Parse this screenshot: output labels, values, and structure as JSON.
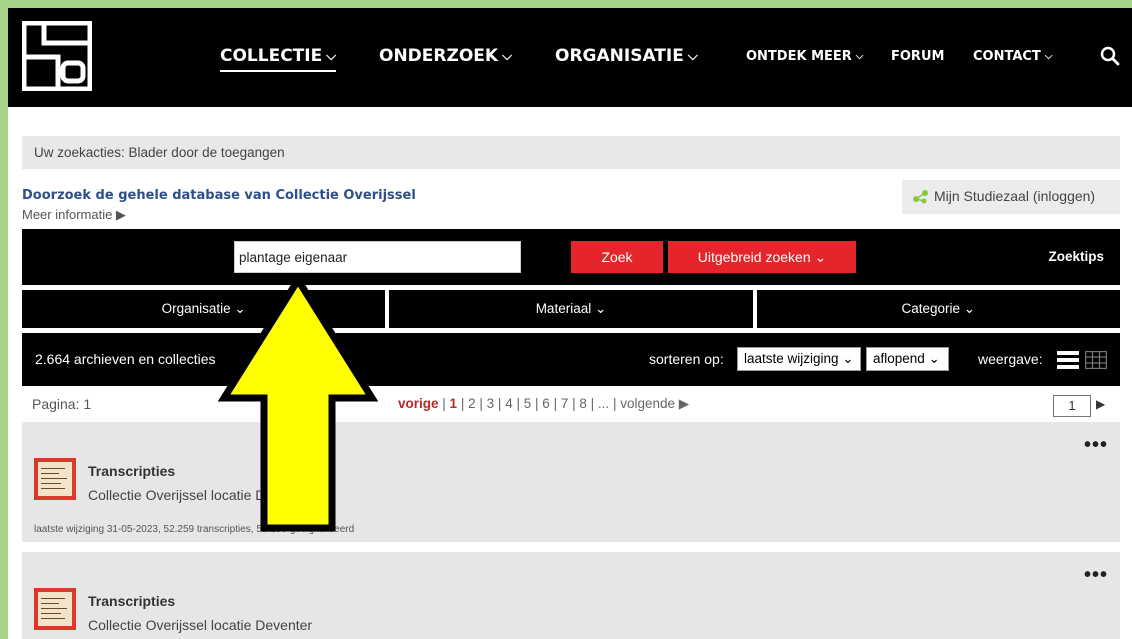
{
  "nav": {
    "items": [
      {
        "label": "COLLECTIE",
        "chevron": true
      },
      {
        "label": "ONDERZOEK",
        "chevron": true
      },
      {
        "label": "ORGANISATIE",
        "chevron": true
      },
      {
        "label": "ONTDEK MEER",
        "chevron": true
      },
      {
        "label": "FORUM",
        "chevron": false
      },
      {
        "label": "CONTACT",
        "chevron": true
      }
    ]
  },
  "breadcrumb": "Uw zoekacties: Blader door de toegangen",
  "database_link": "Doorzoek de gehele database van Collectie Overijssel",
  "more_info": "Meer informatie ▶",
  "studiezaal": "Mijn Studiezaal (inloggen)",
  "search": {
    "value": "plantage eigenaar",
    "zoek_label": "Zoek",
    "advanced_label": "Uitgebreid zoeken ⌄",
    "tips_label": "Zoektips"
  },
  "filters": {
    "organisatie": "Organisatie ⌄",
    "materiaal": "Materiaal ⌄",
    "categorie": "Categorie ⌄"
  },
  "results": {
    "count": "2.664 archieven en collecties",
    "sort_label": "sorteren op:",
    "sort_value": "laatste wijziging ⌄",
    "order_value": "aflopend ⌄",
    "view_label": "weergave:"
  },
  "pagination": {
    "label": "Pagina: 1",
    "prev": "vorige",
    "pages": [
      "1",
      "2",
      "3",
      "4",
      "5",
      "6",
      "7",
      "8",
      "..."
    ],
    "next": "volgende ▶",
    "current": "1",
    "next_arrow": "▶"
  },
  "items": [
    {
      "title": "Transcripties",
      "subtitle": "Collectie Overijssel locatie Deventer",
      "meta": "laatste wijziging 31-05-2023, 52.259 transcripties, 52.259 gedigitaliseerd",
      "menu": "•••"
    },
    {
      "title": "Transcripties",
      "subtitle": "Collectie Overijssel locatie Deventer",
      "menu": "•••"
    }
  ],
  "colors": {
    "header_bg": "#000000",
    "accent_red": "#e4252b",
    "link_blue": "#2d4f8e",
    "arrow_yellow": "#ffff00",
    "page_border_green": "#a8d48a"
  }
}
